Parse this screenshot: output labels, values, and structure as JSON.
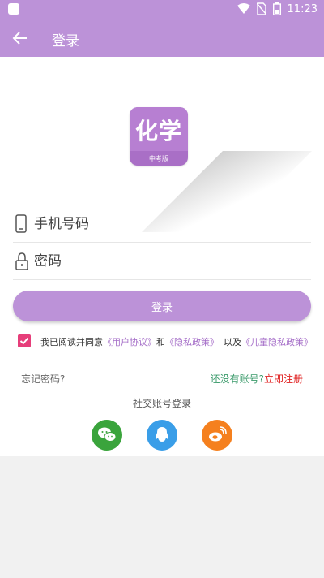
{
  "status_bar": {
    "time": "11:23",
    "icons": [
      "app-icon",
      "wifi-icon",
      "no-sim-icon",
      "battery-icon"
    ]
  },
  "app_bar": {
    "title": "登录",
    "back_icon": "arrow-left-icon"
  },
  "logo": {
    "text": "化学",
    "subtitle": "中考版"
  },
  "form": {
    "phone": {
      "placeholder": "手机号码",
      "value": "",
      "icon": "phone-icon"
    },
    "password": {
      "placeholder": "密码",
      "value": "",
      "icon": "lock-icon"
    },
    "login_button": "登录"
  },
  "agreement": {
    "checked": true,
    "prefix": "我已阅读并同意",
    "user_agreement": "《用户协议》",
    "and": "和",
    "privacy_policy": "《隐私政策》",
    "and2": "以及",
    "children_policy": "《儿童隐私政策》"
  },
  "links": {
    "forgot_password": "忘记密码?",
    "no_account": "还没有账号?",
    "register_now": "立即注册"
  },
  "social": {
    "title": "社交账号登录",
    "providers": [
      "wechat-icon",
      "qq-icon",
      "weibo-icon"
    ]
  },
  "colors": {
    "accent": "#bc92d8",
    "checkbox": "#e63e7a",
    "link": "#a56ec8",
    "register": "#e02020",
    "wechat": "#3aa43c",
    "qq": "#3a9ee8",
    "weibo": "#f5801e"
  }
}
